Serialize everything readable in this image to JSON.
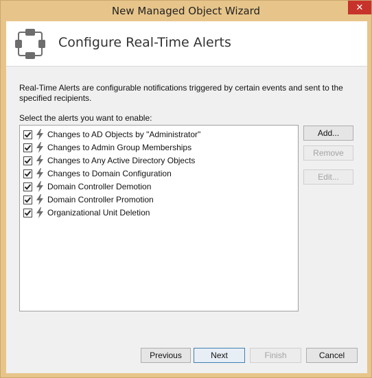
{
  "window": {
    "title": "New Managed Object Wizard",
    "close_glyph": "✕"
  },
  "header": {
    "title": "Configure Real-Time Alerts",
    "icon": "nodes-icon"
  },
  "description": "Real-Time Alerts are configurable notifications triggered by certain events and sent to the specified recipients.",
  "select_label": "Select the alerts you want to enable:",
  "alerts": [
    {
      "label": "Changes to AD Objects by \"Administrator\"",
      "checked": true
    },
    {
      "label": "Changes to Admin Group Memberships",
      "checked": true
    },
    {
      "label": "Changes to Any Active Directory Objects",
      "checked": true
    },
    {
      "label": "Changes to Domain Configuration",
      "checked": true
    },
    {
      "label": "Domain Controller Demotion",
      "checked": true
    },
    {
      "label": "Domain Controller Promotion",
      "checked": true
    },
    {
      "label": "Organizational Unit Deletion",
      "checked": true
    }
  ],
  "side_buttons": {
    "add": "Add...",
    "remove": "Remove",
    "edit": "Edit..."
  },
  "footer_buttons": {
    "previous": "Previous",
    "next": "Next",
    "finish": "Finish",
    "cancel": "Cancel"
  },
  "colors": {
    "accent": "#3c7fb1",
    "icon_gray": "#6d6d6d",
    "close_red": "#c7332b"
  }
}
